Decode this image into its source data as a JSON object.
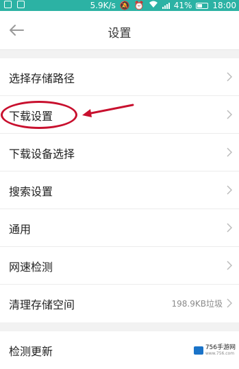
{
  "status_bar": {
    "network_speed": "5.9K/s",
    "battery_percent": "41%",
    "time": "18:00"
  },
  "header": {
    "title": "设置"
  },
  "settings_group_1": [
    {
      "label": "选择存储路径",
      "value": ""
    },
    {
      "label": "下载设置",
      "value": ""
    },
    {
      "label": "下载设备选择",
      "value": ""
    },
    {
      "label": "搜索设置",
      "value": ""
    },
    {
      "label": "通用",
      "value": ""
    },
    {
      "label": "网速检测",
      "value": ""
    },
    {
      "label": "清理存储空间",
      "value": "198.9KB垃圾"
    }
  ],
  "settings_group_2": [
    {
      "label": "检测更新",
      "value": ""
    }
  ],
  "watermark": {
    "text": "756手游网",
    "sub": "www.756.com"
  },
  "colors": {
    "status_bar": "#2cb2a4",
    "annotation": "#c8102e"
  }
}
